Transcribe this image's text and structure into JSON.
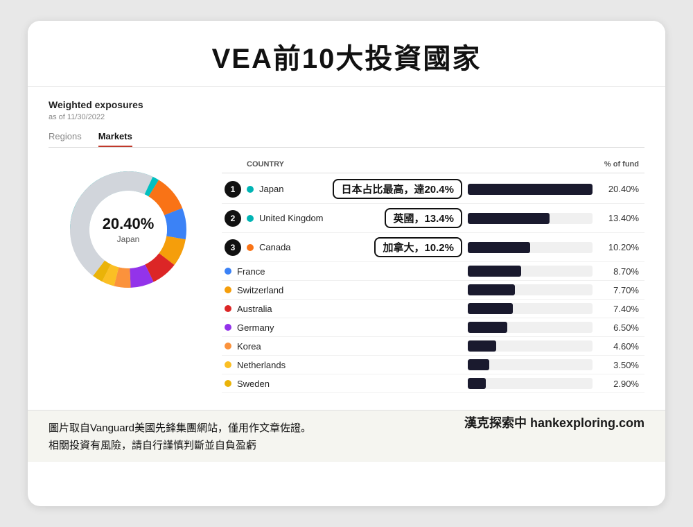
{
  "title": "VEA前10大投資國家",
  "section_label": "Weighted exposures",
  "as_of": "as of 11/30/2022",
  "tabs": [
    {
      "label": "Regions",
      "active": false
    },
    {
      "label": "Markets",
      "active": true
    }
  ],
  "donut": {
    "percent": "20.40%",
    "label": "Japan"
  },
  "table_header": {
    "country_col": "COUNTRY",
    "pct_col": "% of fund"
  },
  "countries": [
    {
      "rank": 1,
      "name": "Japan",
      "pct": 20.4,
      "pct_label": "20.40%",
      "color": "#00b4b4",
      "callout": "日本占比最高，達20.4%"
    },
    {
      "rank": 2,
      "name": "United Kingdom",
      "pct": 13.4,
      "pct_label": "13.40%",
      "color": "#00b4b4",
      "callout": "英國，13.4%"
    },
    {
      "rank": 3,
      "name": "Canada",
      "pct": 10.2,
      "pct_label": "10.20%",
      "color": "#f97316",
      "callout": "加拿大，10.2%"
    },
    {
      "rank": null,
      "name": "France",
      "pct": 8.7,
      "pct_label": "8.70%",
      "color": "#3b82f6",
      "callout": null
    },
    {
      "rank": null,
      "name": "Switzerland",
      "pct": 7.7,
      "pct_label": "7.70%",
      "color": "#f97316",
      "callout": null
    },
    {
      "rank": null,
      "name": "Australia",
      "pct": 7.4,
      "pct_label": "7.40%",
      "color": "#dc2626",
      "callout": null
    },
    {
      "rank": null,
      "name": "Germany",
      "pct": 6.5,
      "pct_label": "6.50%",
      "color": "#9333ea",
      "callout": null
    },
    {
      "rank": null,
      "name": "Korea",
      "pct": 4.6,
      "pct_label": "4.60%",
      "color": "#f97316",
      "callout": null
    },
    {
      "rank": null,
      "name": "Netherlands",
      "pct": 3.5,
      "pct_label": "3.50%",
      "color": "#f97316",
      "callout": null
    },
    {
      "rank": null,
      "name": "Sweden",
      "pct": 2.9,
      "pct_label": "2.90%",
      "color": "#eab308",
      "callout": null
    }
  ],
  "footer": {
    "line1": "圖片取自Vanguard美國先鋒集團網站，僅用作文章佐證。",
    "line2": "相關投資有風險，請自行謹慎判斷並自負盈虧",
    "brand": "漢克探索中 hankexploring.com"
  }
}
